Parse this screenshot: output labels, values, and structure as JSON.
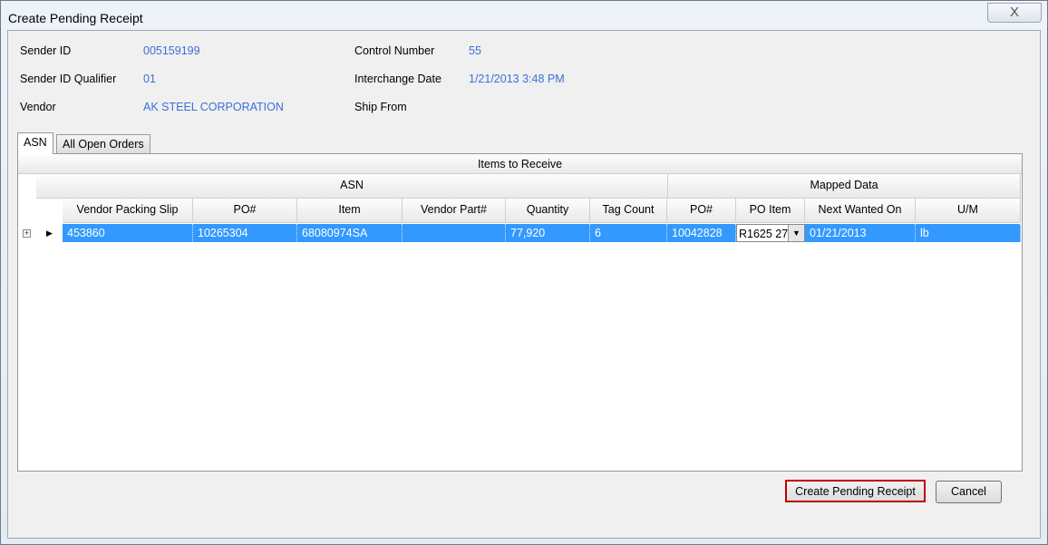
{
  "window": {
    "title": "Create Pending Receipt",
    "close_icon": "X"
  },
  "fields": [
    {
      "label": "Sender ID",
      "value": "005159199"
    },
    {
      "label": "Sender ID Qualifier",
      "value": "01"
    },
    {
      "label": "Vendor",
      "value": "AK STEEL CORPORATION"
    },
    {
      "label": "Control Number",
      "value": "55"
    },
    {
      "label": "Interchange Date",
      "value": "1/21/2013 3:48 PM"
    },
    {
      "label": "Ship From",
      "value": ""
    }
  ],
  "tabs": [
    {
      "label": "ASN",
      "active": true
    },
    {
      "label": "All Open Orders",
      "active": false
    }
  ],
  "grid": {
    "title": "Items to Receive",
    "groups": [
      "ASN",
      "Mapped Data"
    ],
    "columns": [
      "Vendor Packing Slip",
      "PO#",
      "Item",
      "Vendor Part#",
      "Quantity",
      "Tag Count",
      "PO#",
      "PO Item",
      "Next Wanted On",
      "U/M"
    ],
    "rows": [
      [
        "453860",
        "10265304",
        "68080974SA",
        "",
        "77,920",
        "6",
        "10042828",
        "R1625 27",
        "01/21/2013",
        "lb"
      ]
    ],
    "selection_color": "#3399ff"
  },
  "buttons": {
    "create": "Create Pending Receipt",
    "cancel": "Cancel",
    "highlight_color": "#c00000"
  }
}
